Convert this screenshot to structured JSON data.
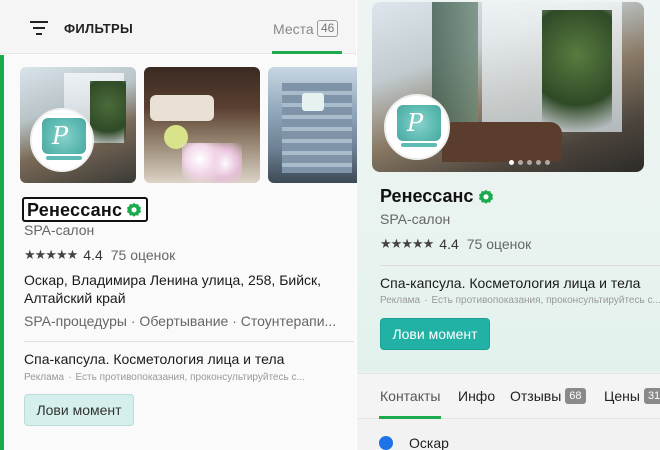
{
  "topbar": {
    "filters_label": "ФИЛЬТРЫ",
    "places_tab": {
      "label": "Места",
      "count": "46"
    }
  },
  "card": {
    "title": "Ренессанс",
    "category": "SPA-салон",
    "rating": "4.4",
    "reviews": "75 оценок",
    "address": "Оскар, Владимира Ленина улица, 258, Бийск, Алтайский край",
    "services": "SPA-процедуры · Обертывание · Стоунтерапи...",
    "ad": {
      "title": "Спа-капсула. Косметология лица и тела",
      "label": "Реклама",
      "disclaimer": "Есть противопоказания, проконсультируйтесь с...",
      "button": "Лови момент"
    }
  },
  "detail": {
    "title": "Ренессанс",
    "category": "SPA-салон",
    "rating": "4.4",
    "reviews": "75 оценок",
    "ad": {
      "title": "Спа-капсула. Косметология лица и тела",
      "label": "Реклама",
      "disclaimer": "Есть противопоказания, проконсультируйтесь с...",
      "button": "Лови момент"
    },
    "tabs": [
      {
        "label": "Контакты"
      },
      {
        "label": "Инфо"
      },
      {
        "label": "Отзывы",
        "count": "68"
      },
      {
        "label": "Цены",
        "count": "31"
      }
    ],
    "contact_first": "Оскар"
  },
  "logo_text": "Р",
  "stars": "★★★★★",
  "colors": {
    "accent": "#1baa4c",
    "cta": "#22b1a5",
    "cta_light": "#d4efec"
  }
}
